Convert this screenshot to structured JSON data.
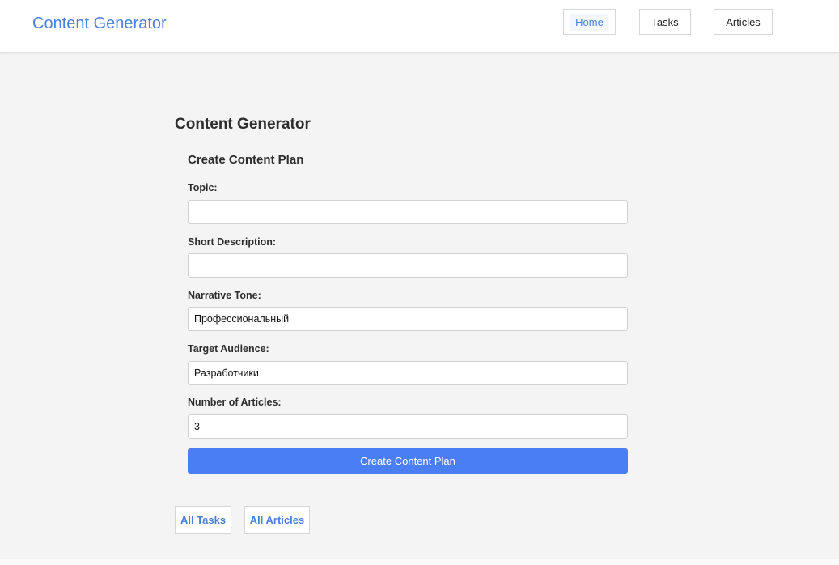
{
  "header": {
    "brand": "Content Generator",
    "nav": {
      "home": "Home",
      "tasks": "Tasks",
      "articles": "Articles"
    }
  },
  "main": {
    "title": "Content Generator",
    "form": {
      "title": "Create Content Plan",
      "topic": {
        "label": "Topic:",
        "value": ""
      },
      "description": {
        "label": "Short Description:",
        "value": ""
      },
      "tone": {
        "label": "Narrative Tone:",
        "value": "Профессиональный"
      },
      "audience": {
        "label": "Target Audience:",
        "value": "Разработчики"
      },
      "count": {
        "label": "Number of Articles:",
        "value": "3"
      },
      "submit_label": "Create Content Plan"
    },
    "links": {
      "all_tasks": "All Tasks",
      "all_articles": "All Articles"
    }
  },
  "colors": {
    "accent": "#4a7fe0",
    "button": "#4a7ef5",
    "background": "#f4f4f4"
  }
}
